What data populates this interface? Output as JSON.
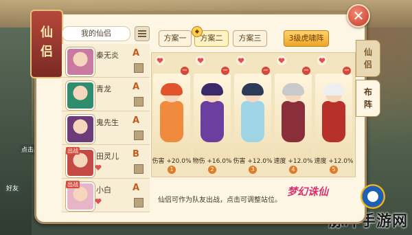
{
  "panel": {
    "title": [
      "仙",
      "侣"
    ],
    "my_companions_label": "我的仙侣"
  },
  "companions": [
    {
      "name": "秦无炎",
      "grade": "A",
      "new_tag": "",
      "accent": "#c87aa0",
      "has_heart": false
    },
    {
      "name": "青龙",
      "grade": "A",
      "new_tag": "",
      "accent": "#2f8c6d",
      "has_heart": false
    },
    {
      "name": "鬼先生",
      "grade": "A",
      "new_tag": "",
      "accent": "#6d3a7a",
      "has_heart": false
    },
    {
      "name": "田灵儿",
      "grade": "B",
      "new_tag": "出战",
      "accent": "#c44a44",
      "has_heart": true
    },
    {
      "name": "小白",
      "grade": "A",
      "new_tag": "出战",
      "accent": "#e8b4c8",
      "has_heart": true
    }
  ],
  "tabs": [
    {
      "label": "方案一",
      "state": "plain"
    },
    {
      "label": "方案二",
      "state": "active"
    },
    {
      "label": "方案三",
      "state": "plain"
    },
    {
      "label": "3级虎啸阵",
      "state": "gold"
    }
  ],
  "active_badge": "◆",
  "formation_slots": [
    {
      "stat": "伤害 +20.0%",
      "index": "1",
      "colors": {
        "hair": "#e0532c",
        "body": "#f08a3c"
      }
    },
    {
      "stat": "物伤 +16.0%",
      "index": "2",
      "colors": {
        "hair": "#3b2a6b",
        "body": "#6a3fa0"
      }
    },
    {
      "stat": "伤害 +12.0%",
      "index": "3",
      "colors": {
        "hair": "#2c3a5a",
        "body": "#9fd3e6"
      }
    },
    {
      "stat": "速度 +12.0%",
      "index": "4",
      "colors": {
        "hair": "#c9c9c9",
        "body": "#8a2f3a"
      }
    },
    {
      "stat": "速度 +12.0%",
      "index": "5",
      "colors": {
        "hair": "#efefef",
        "body": "#b7312a"
      }
    }
  ],
  "side_tabs": [
    {
      "chars": [
        "仙",
        "侣"
      ],
      "state": "inactive"
    },
    {
      "chars": [
        "布",
        "阵"
      ],
      "state": "active"
    }
  ],
  "footer_note": "仙侣可作为队友出战，点击可调整站位。",
  "game_logo": "梦幻诛仙",
  "background": {
    "chip_1": "点击战",
    "chip_2": "好友",
    "watermark": "脉冲手游网"
  }
}
